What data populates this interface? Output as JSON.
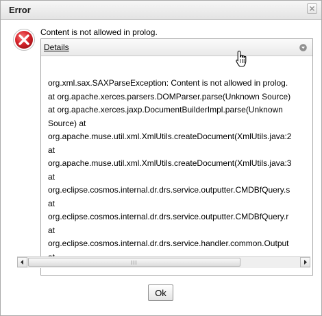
{
  "dialog": {
    "title": "Error",
    "message": "Content is not allowed in prolog.",
    "details_label": "Details",
    "ok_label": "Ok"
  },
  "details": {
    "lines": [
      "org.xml.sax.SAXParseException: Content is not allowed in prolog.",
      "at org.apache.xerces.parsers.DOMParser.parse(Unknown Source)",
      "at org.apache.xerces.jaxp.DocumentBuilderImpl.parse(Unknown",
      "Source) at",
      "org.apache.muse.util.xml.XmlUtils.createDocument(XmlUtils.java:2",
      "at",
      "org.apache.muse.util.xml.XmlUtils.createDocument(XmlUtils.java:3",
      "at",
      "org.eclipse.cosmos.internal.dr.drs.service.outputter.CMDBfQuery.s",
      "at",
      "org.eclipse.cosmos.internal.dr.drs.service.outputter.CMDBfQuery.r",
      "at",
      "org.eclipse.cosmos.internal.dr.drs.service.handler.common.Output",
      "at"
    ]
  },
  "icons": {
    "error": "error-x-icon",
    "close": "close-icon",
    "chevron": "chevron-down-icon",
    "cursor": "hand-cursor-icon"
  },
  "colors": {
    "error_red": "#d8232a"
  }
}
